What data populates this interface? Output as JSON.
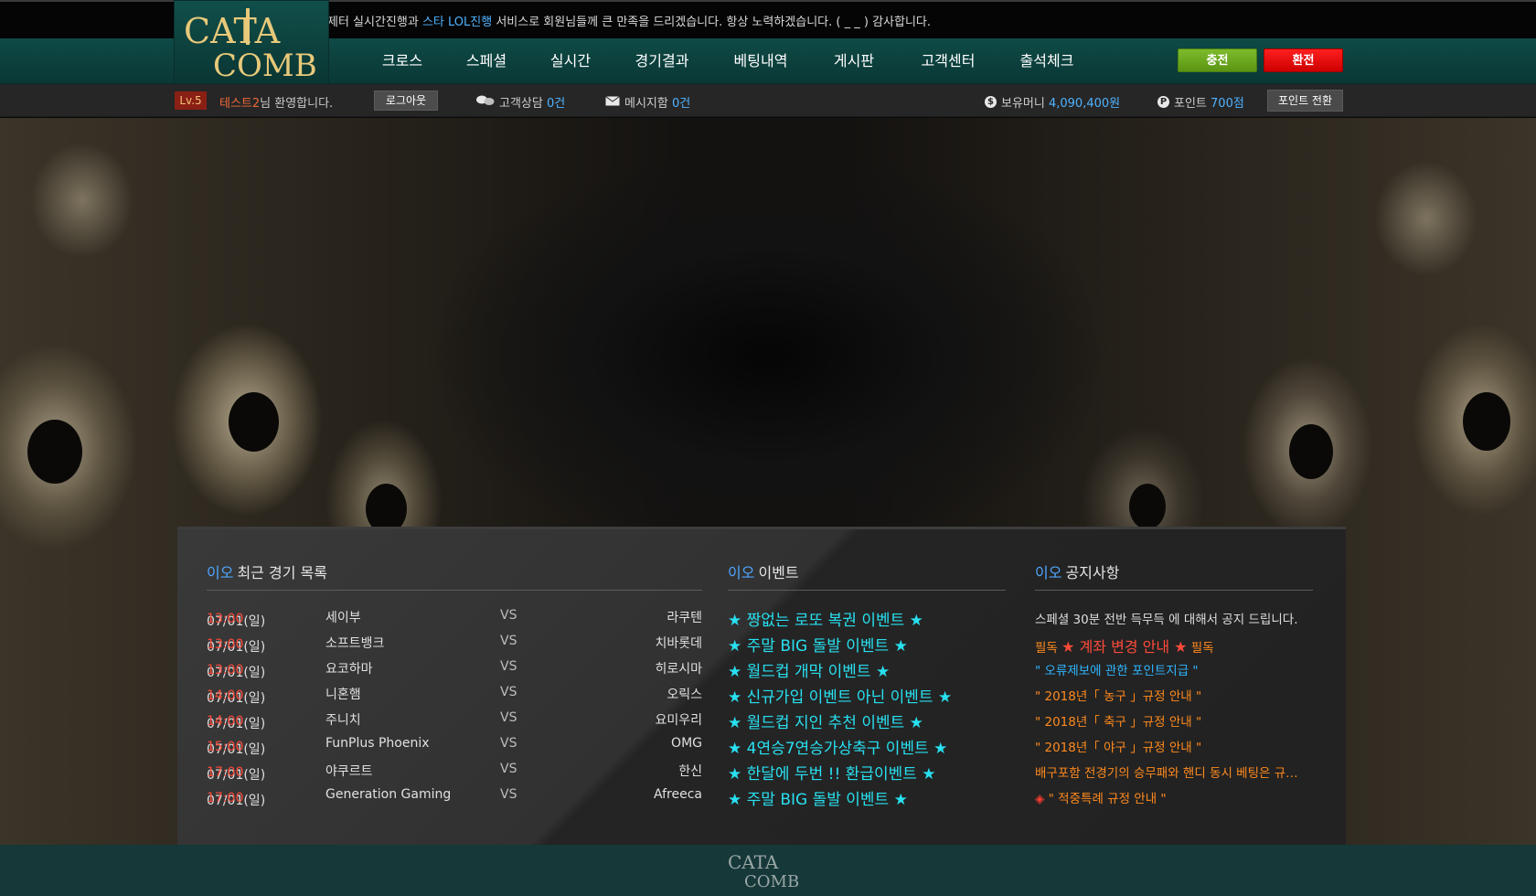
{
  "marquee": {
    "part1": "제터 실시간진행과 ",
    "highlight": "스타 LOL진행",
    "part2": " 서비스로 회원님들께 큰 만족을 드리겠습니다. 항상 노력하겠습니다. ( _ _ ) 감사합니다."
  },
  "logo": {
    "line1": "CATA",
    "line2": "COMB"
  },
  "nav": {
    "items": [
      "크로스",
      "스페셜",
      "실시간",
      "경기결과",
      "베팅내역",
      "게시판",
      "고객센터",
      "출석체크"
    ],
    "charge_label": "충전",
    "exchange_label": "환전"
  },
  "user": {
    "level": "Lv.5",
    "name": "테스트2",
    "greeting": "님 환영합니다.",
    "logout_label": "로그아웃",
    "consult_label": "고객상담",
    "consult_count": "0건",
    "message_label": "메시지함",
    "message_count": "0건",
    "money_icon": "$",
    "money_label": "보유머니",
    "money_value": "4,090,400원",
    "point_icon": "P",
    "point_label": "포인트",
    "point_value": "700점",
    "point_convert_label": "포인트 전환"
  },
  "games": {
    "prefix": "이오",
    "title": "최근 경기 목록",
    "vs": "VS",
    "rows": [
      {
        "date": "07/01(일)",
        "time": "13:00",
        "home": "세이부",
        "away": "라쿠텐"
      },
      {
        "date": "07/01(일)",
        "time": "13:00",
        "home": "소프트뱅크",
        "away": "치바롯데"
      },
      {
        "date": "07/01(일)",
        "time": "13:00",
        "home": "요코하마",
        "away": "히로시마"
      },
      {
        "date": "07/01(일)",
        "time": "14:00",
        "home": "니혼햄",
        "away": "오릭스"
      },
      {
        "date": "07/01(일)",
        "time": "14:00",
        "home": "주니치",
        "away": "요미우리"
      },
      {
        "date": "07/01(일)",
        "time": "15:00",
        "home": "FunPlus Phoenix",
        "away": "OMG"
      },
      {
        "date": "07/01(일)",
        "time": "17:00",
        "home": "야쿠르트",
        "away": "한신"
      },
      {
        "date": "07/01(일)",
        "time": "17:00",
        "home": "Generation Gaming",
        "away": "Afreeca"
      }
    ]
  },
  "events": {
    "prefix": "이오",
    "title": "이벤트",
    "items": [
      "★ 짱없는 로또 복권 이벤트 ★",
      "★ 주말 BIG 돌발 이벤트 ★",
      "★ 월드컵 개막 이벤트 ★",
      "★ 신규가입 이벤트 아닌 이벤트 ★",
      "★ 월드컵 지인 추천 이벤트 ★",
      "★ 4연승7연승가상축구 이벤트 ★",
      "★ 한달에 두번 !! 환급이벤트 ★",
      "★ 주말 BIG 돌발 이벤트 ★"
    ]
  },
  "notices": {
    "prefix": "이오",
    "title": "공지사항",
    "item1": "스페셜 30분 전반 득무득 에 대해서 공지 드립니다.",
    "item2_pre": "필독",
    "item2_main": "★ 계좌 변경 안내 ★",
    "item2_post": "필독",
    "item3": "\" 오류제보에 관한 포인트지급 \"",
    "item4": "\" 2018년「 농구 」규정 안내 \"",
    "item5": "\" 2018년「 축구 」규정 안내 \"",
    "item6": "\" 2018년「 야구 」규정 안내 \"",
    "item7": "배구포함 전경기의 승무패와 핸디 동시 베팅은 규…",
    "item8_icon": "◈",
    "item8": " \" 적중특례 규정 안내 \""
  },
  "footer": {
    "logo_line1": "CATA",
    "logo_line2": "COMB"
  }
}
